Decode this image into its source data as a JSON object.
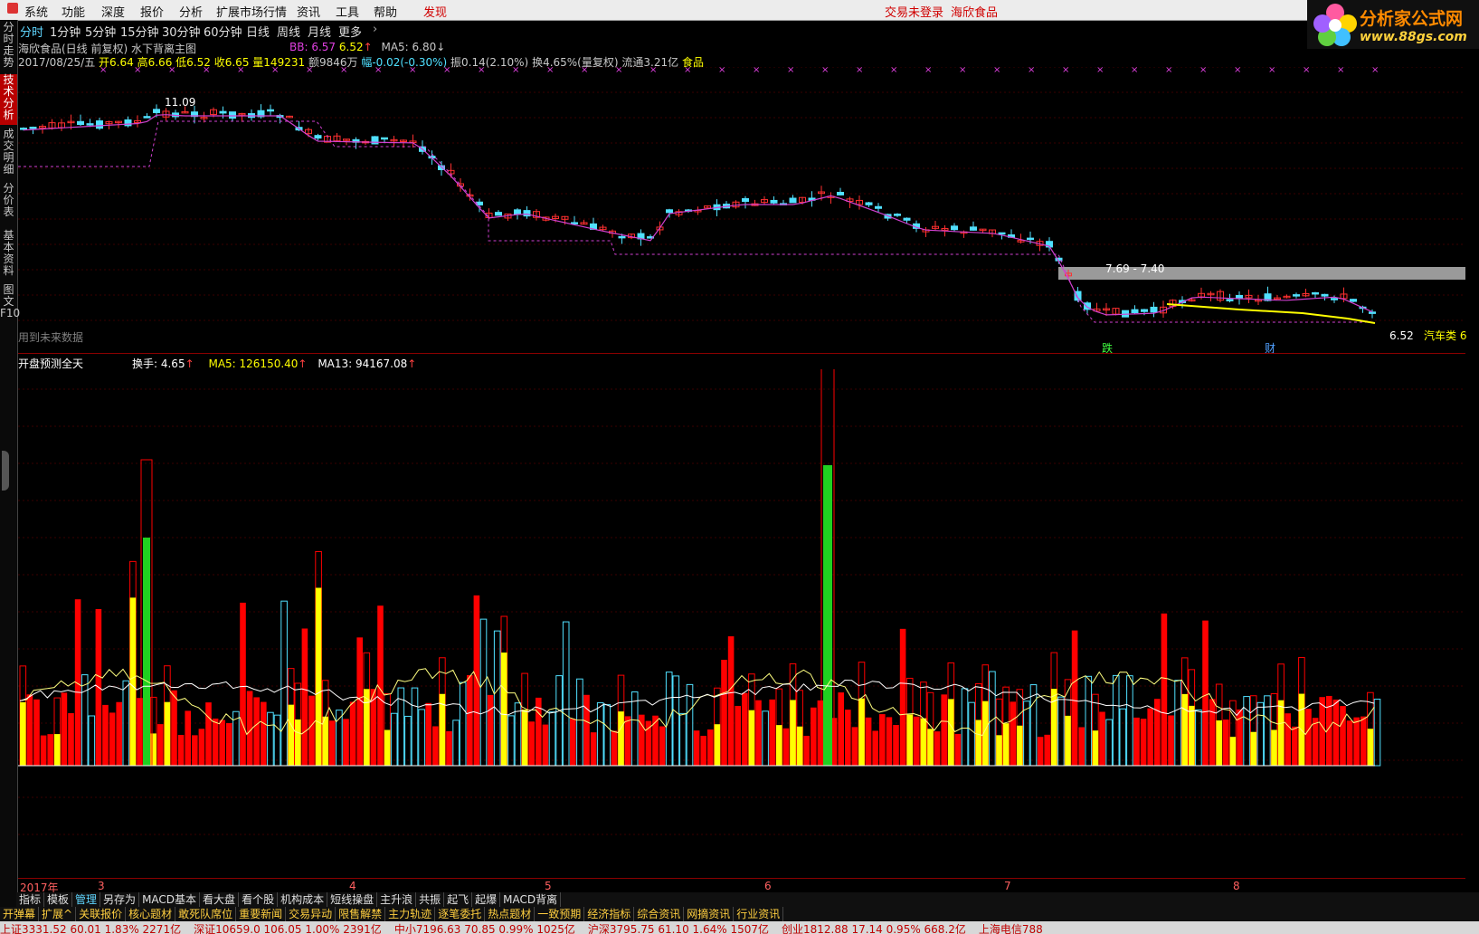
{
  "menu": {
    "items": [
      "系统",
      "功能",
      "深度",
      "报价",
      "分析",
      "扩展市场行情",
      "资讯",
      "工具",
      "帮助",
      "发现"
    ],
    "login_status": "交易未登录",
    "stock_link": "海欣食品"
  },
  "logo": {
    "title": "分析家公式网",
    "url": "www.88gs.com"
  },
  "left_tabs": [
    "分时走势",
    "技术分析",
    "成交明细",
    "分价表",
    "基本资料",
    "图文F10"
  ],
  "periods": [
    "分时",
    "1分钟",
    "5分钟",
    "15分钟",
    "30分钟",
    "60分钟",
    "日线",
    "周线",
    "月线",
    "更多"
  ],
  "main_chart": {
    "title": "海欣食品(日线 前复权) 水下背离主图",
    "bb_label": "BB: 6.57",
    "bb_value": "6.52",
    "ma5_label": "MA5: 6.80",
    "date": "2017/08/25/五",
    "open": "开6.64",
    "high": "高6.66",
    "low": "低6.52",
    "close": "收6.65",
    "volume": "量149231",
    "amount": "额9846万",
    "change": "幅-0.02(-0.30%)",
    "amplitude": "振0.14(2.10%)",
    "turnover": "换4.65%(量复权)",
    "float": "流通3.21亿",
    "sector": "食品",
    "peak_label": "11.09",
    "range_label": "7.69 - 7.40",
    "low_label": "6.52",
    "sector_tag": "汽车类 6",
    "future_note": "用到未来数据",
    "event_die": "跌",
    "event_cai": "财"
  },
  "sub_chart": {
    "title": "开盘预测全天",
    "turnover": "换手: 4.65",
    "ma5": "MA5: 126150.40",
    "ma13": "MA13: 94167.08"
  },
  "time_axis": [
    "2017年",
    "3",
    "4",
    "5",
    "6",
    "7",
    "8"
  ],
  "bottom_tabs_1": [
    "指标",
    "模板",
    "管理",
    "另存为",
    "MACD基本",
    "看大盘",
    "看个股",
    "机构成本",
    "短线操盘",
    "主升浪",
    "共振",
    "起飞",
    "起爆",
    "MACD背离"
  ],
  "bottom_tabs_2": [
    "开弹幕",
    "扩展^",
    "关联报价",
    "核心题材",
    "敢死队席位",
    "重要新闻",
    "交易异动",
    "限售解禁",
    "主力轨迹",
    "逐笔委托",
    "热点题材",
    "一致预期",
    "经济指标",
    "综合资讯",
    "网摘资讯",
    "行业资讯"
  ],
  "status_bar": [
    "上证3331.52  60.01  1.83%  2271亿",
    "深证10659.0  106.05  1.00%  2391亿",
    "中小7196.63  70.85  0.99%  1025亿",
    "沪深3795.75  61.10  1.64%  1507亿",
    "创业1812.88  17.14  0.95%  668.2亿",
    "上海电信788"
  ],
  "colors": {
    "up": "#ff3030",
    "down": "#50e0ff",
    "ma": "#d040d0",
    "bb": "#ffff00",
    "vol_up": "#ff0000",
    "vol_hl": "#ffff00"
  }
}
